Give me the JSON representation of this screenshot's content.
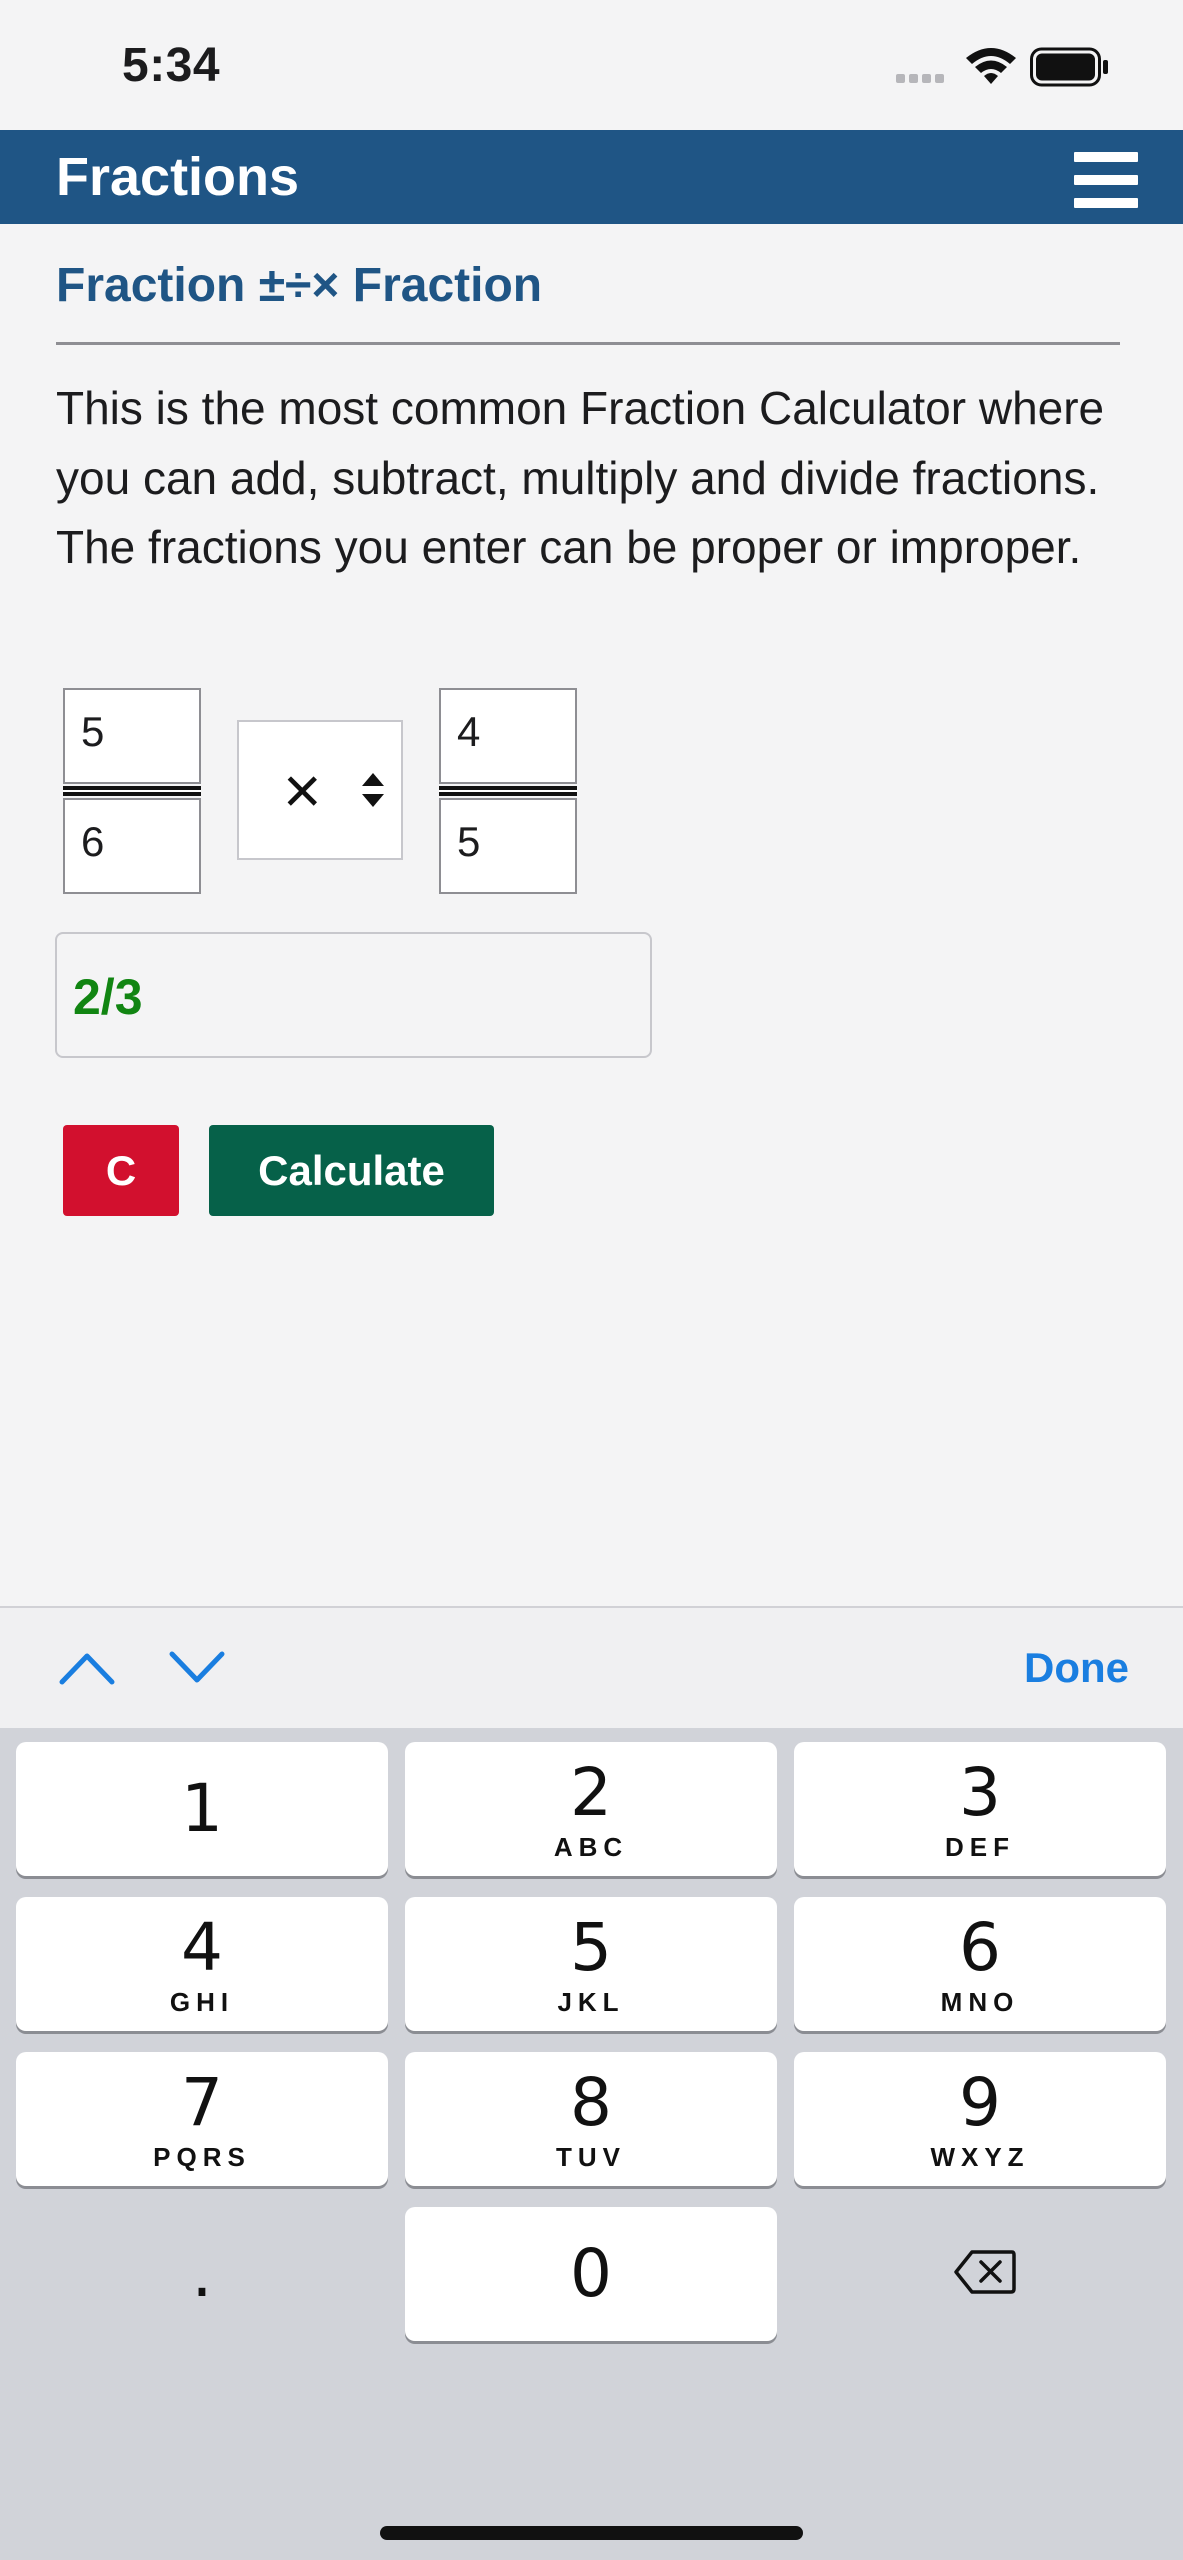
{
  "status_bar": {
    "time": "5:34"
  },
  "header": {
    "title": "Fractions",
    "menu_icon": "hamburger-menu-icon",
    "background_color": "#1f5585"
  },
  "calculator": {
    "heading": "Fraction ±÷× Fraction",
    "description": "This is the most common Fraction Calculator where you can add, subtract, multiply and divide fractions. The fractions you enter can be proper or improper.",
    "fraction1": {
      "numerator": "5",
      "denominator": "6"
    },
    "operator": "×",
    "fraction2": {
      "numerator": "4",
      "denominator": "5"
    },
    "result": "2/3",
    "result_color": "#118512",
    "clear_label": "C",
    "clear_color": "#d2102e",
    "calculate_label": "Calculate",
    "calculate_color": "#066149"
  },
  "keyboard": {
    "accessory": {
      "prev_icon": "chevron-up-icon",
      "next_icon": "chevron-down-icon",
      "done_label": "Done"
    },
    "keys": [
      {
        "digit": "1",
        "letters": ""
      },
      {
        "digit": "2",
        "letters": "ABC"
      },
      {
        "digit": "3",
        "letters": "DEF"
      },
      {
        "digit": "4",
        "letters": "GHI"
      },
      {
        "digit": "5",
        "letters": "JKL"
      },
      {
        "digit": "6",
        "letters": "MNO"
      },
      {
        "digit": "7",
        "letters": "PQRS"
      },
      {
        "digit": "8",
        "letters": "TUV"
      },
      {
        "digit": "9",
        "letters": "WXYZ"
      },
      {
        "digit": ".",
        "letters": ""
      },
      {
        "digit": "0",
        "letters": ""
      },
      {
        "digit": "",
        "letters": "",
        "icon": "backspace-icon"
      }
    ]
  }
}
